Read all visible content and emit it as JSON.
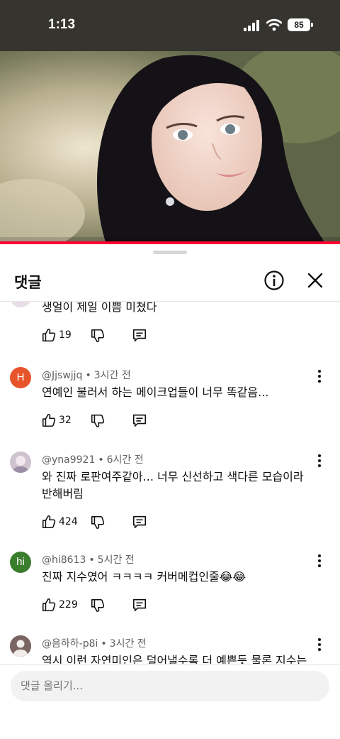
{
  "status": {
    "time": "1:13",
    "battery": "85"
  },
  "sheet": {
    "title": "댓글",
    "input_placeholder": "댓글 올리기..."
  },
  "comments": [
    {
      "text": "생얼이 제일 이쁨 미쳤다",
      "likes": "19"
    },
    {
      "avatar_letter": "H",
      "avatar_color": "#e8542a",
      "author": "@Jjswjjq",
      "time": "3시간 전",
      "text": "연예인 불러서 하는 메이크업들이 너무 똑같음...",
      "likes": "32"
    },
    {
      "author": "@yna9921",
      "time": "6시간 전",
      "text": "와 진짜 로판여주같아... 너무 신선하고 색다른 모습이라 반해버림",
      "likes": "424"
    },
    {
      "avatar_letter": "hi",
      "avatar_color": "#3a7d2c",
      "author": "@hi8613",
      "time": "5시간 전",
      "text": "진짜 지수였어 ㅋㅋㅋㅋ 커버메컵인줄😂😂",
      "likes": "229"
    },
    {
      "author": "@음하하-p8i",
      "time": "3시간 전",
      "text": "역시 이런 자연미인은 덜어낼수록 더 예쁜듯 물론 지수는"
    }
  ],
  "colors": {
    "accent": "#ff0033",
    "text": "#0f0f0f",
    "secondary": "#606060"
  }
}
